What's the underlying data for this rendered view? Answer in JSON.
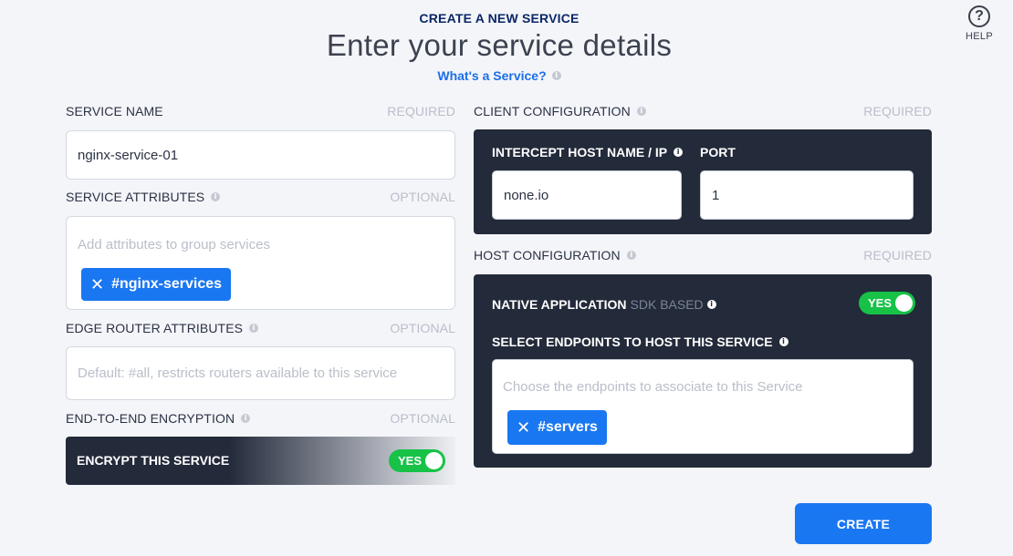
{
  "header": {
    "eyebrow": "CREATE A NEW SERVICE",
    "title": "Enter your service details",
    "link": "What's a Service?"
  },
  "help": {
    "label": "HELP",
    "icon": "question-circle-icon"
  },
  "left": {
    "service_name": {
      "label": "SERVICE NAME",
      "requirement": "REQUIRED",
      "value": "nginx-service-01"
    },
    "service_attributes": {
      "label": "SERVICE ATTRIBUTES",
      "requirement": "OPTIONAL",
      "placeholder": "Add attributes to group services",
      "chips": [
        "#nginx-services"
      ]
    },
    "edge_router_attributes": {
      "label": "EDGE ROUTER ATTRIBUTES",
      "requirement": "OPTIONAL",
      "placeholder": "Default: #all, restricts routers available to this service"
    },
    "encryption": {
      "label": "END-TO-END ENCRYPTION",
      "requirement": "OPTIONAL",
      "toggle_label": "ENCRYPT THIS SERVICE",
      "toggle_value": "YES"
    }
  },
  "right": {
    "client_config": {
      "label": "CLIENT CONFIGURATION",
      "requirement": "REQUIRED",
      "intercept_label": "INTERCEPT HOST NAME / IP",
      "intercept_value": "none.io",
      "port_label": "PORT",
      "port_value": "1"
    },
    "host_config": {
      "label": "HOST CONFIGURATION",
      "requirement": "REQUIRED",
      "native_label": "NATIVE APPLICATION",
      "native_sub": "SDK BASED",
      "native_toggle": "YES",
      "endpoints_label": "SELECT ENDPOINTS TO HOST THIS SERVICE",
      "endpoints_placeholder": "Choose the endpoints to associate to this Service",
      "endpoint_chips": [
        "#servers"
      ]
    }
  },
  "actions": {
    "create_label": "CREATE"
  },
  "colors": {
    "accent": "#1a77f2",
    "dark_panel": "#232a3a",
    "toggle_on": "#17c247",
    "heading": "#0a2766"
  }
}
